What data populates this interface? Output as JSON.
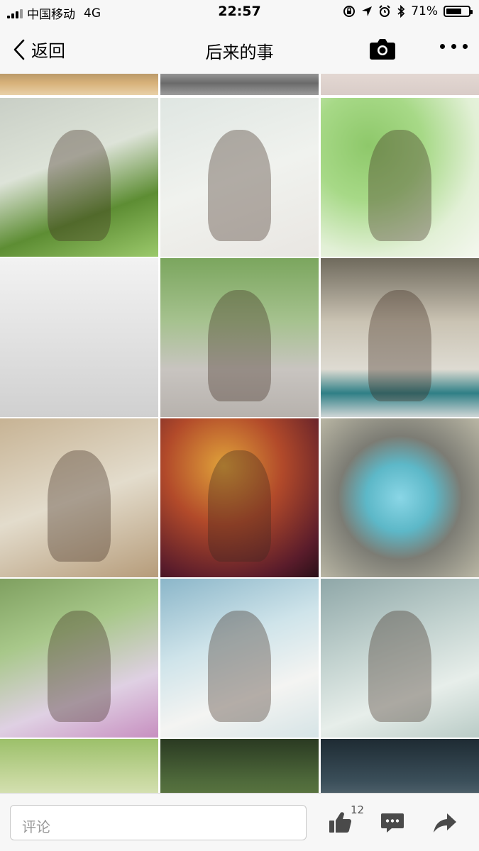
{
  "status_bar": {
    "carrier": "中国移动",
    "network": "4G",
    "time": "22:57",
    "battery_percent": "71%",
    "battery_level": 0.71
  },
  "nav": {
    "back_label": "返回",
    "title": "后来的事"
  },
  "gallery": {
    "photos": [
      {
        "bg": "linear-gradient(180deg,#a0845a 0%,#d8b27a 60%,#e8d0a8 100%)"
      },
      {
        "bg": "linear-gradient(180deg,#bcbcbc 0%,#6a6a6a 60%,#9c9c9c 100%)"
      },
      {
        "bg": "linear-gradient(180deg,#e7dcd6 0%,#d9ccc8 100%)"
      },
      {
        "bg": "linear-gradient(160deg,#c9cfc6 0%,#dde3d8 40%,#5d8d33 70%,#9bc96b 100%)"
      },
      {
        "bg": "linear-gradient(160deg,#dfe6e2 0%,#f0f2ee 50%,#e9e6e2 100%)"
      },
      {
        "bg": "radial-gradient(circle at 30% 30%,#8ec86a 0%,#a7d987 35%,#e2f0d6 70%,#f4f7ef 100%)"
      },
      {
        "bg": "linear-gradient(180deg,#f2f2f2 0%,#e0e0e0 55%,#d0d0d0 100%)"
      },
      {
        "bg": "linear-gradient(180deg,#7ba65e 0%,#a6c28f 40%,#c8c4c0 70%,#b7b2ad 100%)"
      },
      {
        "bg": "linear-gradient(180deg,#6f6a5d 0%,#cac3b3 40%,#dedbd2 70%,#2f7f86 85%,#cfd6d6 100%)"
      },
      {
        "bg": "linear-gradient(160deg,#c7b394 0%,#e3dccc 50%,#b69c7a 100%)"
      },
      {
        "bg": "radial-gradient(circle at 40% 30%,#e0a23a 0%,#b24a2a 40%,#5a1c2b 80%,#2a0f18 100%)"
      },
      {
        "bg": "radial-gradient(circle at 50% 50%,#8ad6e6 0%,#5db8c8 30%,#7c7c74 55%,#b9b6a4 100%)"
      },
      {
        "bg": "linear-gradient(160deg,#7fa060 0%,#a8c88a 35%,#dfd0e3 70%,#c78fc0 100%)"
      },
      {
        "bg": "linear-gradient(160deg,#8bb6c9 0%,#cfe4ea 40%,#f4f4f2 70%,#d6e4e6 100%)"
      },
      {
        "bg": "linear-gradient(160deg,#8fa7a8 0%,#c2d2cf 40%,#e7eeea 70%,#b9cbc6 100%)"
      },
      {
        "bg": "linear-gradient(180deg,#9cc06a 0%,#c9d9a1 50%,#eef0d8 100%)"
      },
      {
        "bg": "linear-gradient(180deg,#2a3a22 0%,#4f6a3b 50%,#6f8a4a 100%)"
      },
      {
        "bg": "linear-gradient(180deg,#1e2b33 0%,#3b4f5a 50%,#7b8890 100%)"
      }
    ]
  },
  "bottom_bar": {
    "comment_placeholder": "评论",
    "like_count": "12"
  },
  "colors": {
    "bar_bg": "#f7f7f7",
    "text": "#000000",
    "muted": "#9a9a9a"
  }
}
